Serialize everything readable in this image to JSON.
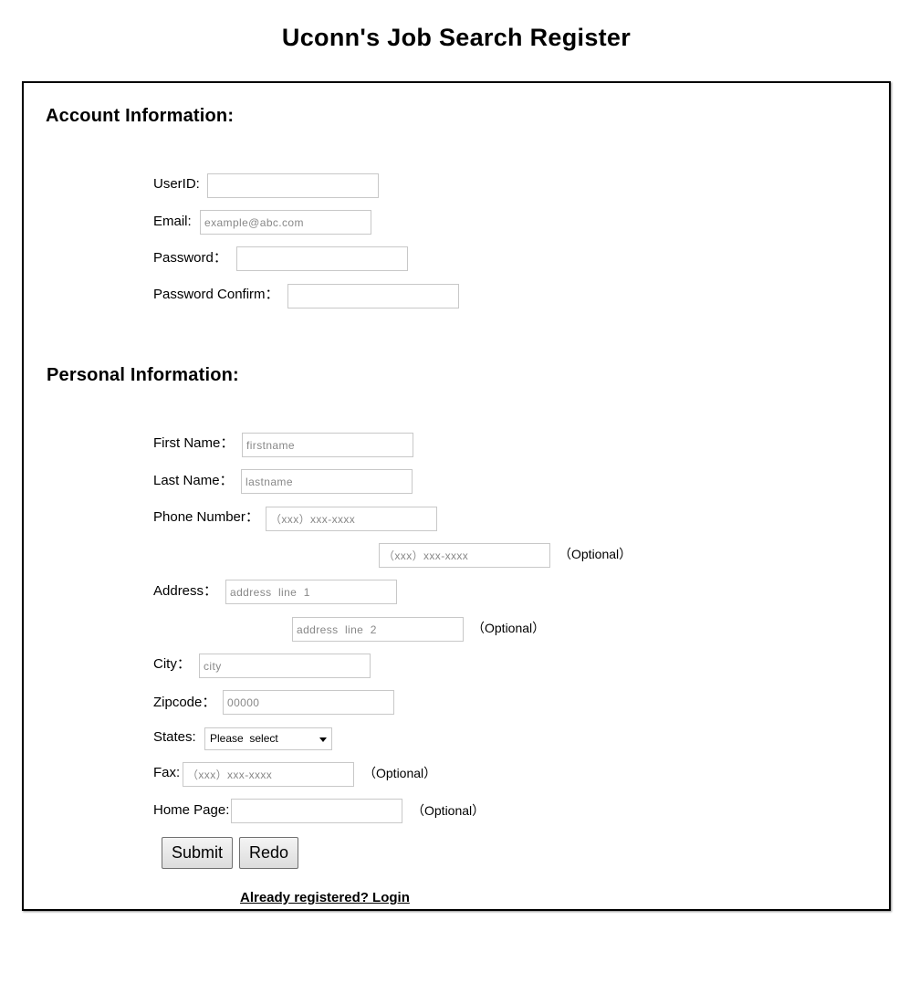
{
  "title": "Uconn's Job Search Register",
  "account": {
    "heading": "Account Information:",
    "userid_label": "UserID:",
    "email_label": "Email:",
    "email_placeholder": "example@abc.com",
    "password_label": "Password：",
    "password_confirm_label": "Password Confirm："
  },
  "personal": {
    "heading": "Personal Information:",
    "firstname_label": "First Name：",
    "firstname_placeholder": "firstname",
    "lastname_label": "Last Name：",
    "lastname_placeholder": "lastname",
    "phone_label": "Phone Number：",
    "phone_placeholder": "（xxx）xxx-xxxx",
    "phone2_placeholder": "（xxx）xxx-xxxx",
    "address_label": "Address：",
    "address1_placeholder": "address  line  1",
    "address2_placeholder": "address  line  2",
    "city_label": "City：",
    "city_placeholder": "city",
    "zipcode_label": "Zipcode：",
    "zipcode_placeholder": "00000",
    "states_label": "States:",
    "states_selected": "Please  select",
    "fax_label": "Fax:",
    "fax_placeholder": "（xxx）xxx-xxxx",
    "homepage_label": "Home Page:",
    "optional_text": "（Optional）"
  },
  "buttons": {
    "submit": "Submit",
    "redo": "Redo"
  },
  "login_link": "Already registered? Login"
}
